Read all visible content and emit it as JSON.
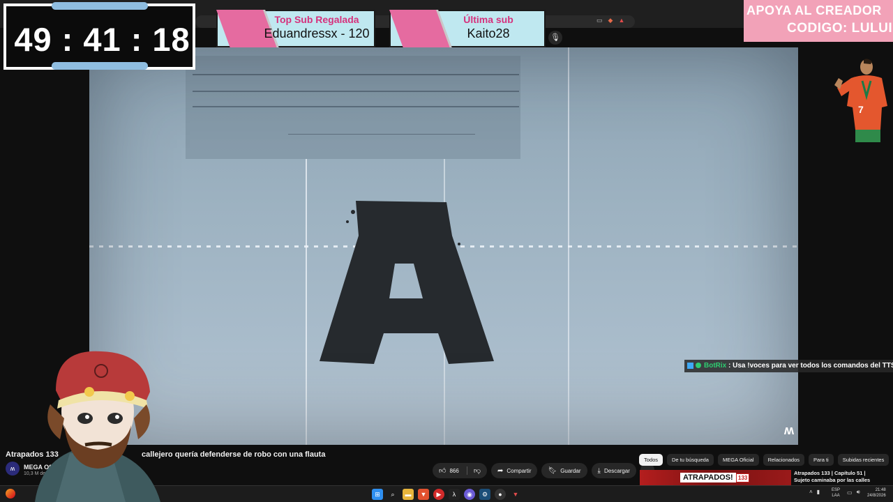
{
  "timer": {
    "value": "49 : 41 : 18"
  },
  "top_sub": {
    "title": "Top Sub Regalada",
    "value": "Eduandressx - 120"
  },
  "last_sub": {
    "title": "Última sub",
    "value": "Kaito28"
  },
  "support": {
    "line1": "APOYA AL CREADOR",
    "line2": "CODIGO: LULUI"
  },
  "chat": {
    "user": "BotRix",
    "message": ": Usa !voces para ver todos los comandos del TTS"
  },
  "video": {
    "title": "Atrapados 133",
    "title_rest": "callejero quería defenderse de robo con una flauta",
    "channel": "MEGA Oficial",
    "subscribers": "10,3 M de susc",
    "letter": "A"
  },
  "actions": {
    "likes": "866",
    "share": "Compartir",
    "save": "Guardar",
    "download": "Descargar",
    "more": "···"
  },
  "chips": [
    "Todos",
    "De tu búsqueda",
    "MEGA Oficial",
    "Relacionados",
    "Para ti",
    "Subidas recientes"
  ],
  "recommended": {
    "thumb_title": "ATRAPADOS!",
    "thumb_num": "133",
    "line1": "Atrapados 133  |  Capítulo 51 |",
    "line2": "Sujeto caminaba por las calles"
  },
  "taskbar": {
    "lang1": "ESP",
    "lang2": "LAA",
    "time": "21:48",
    "date": "24/8/2026"
  },
  "colors": {
    "accent_pink": "#e56ba0",
    "banner_bg": "#bfe8f0",
    "timer_cap": "#8fbde0",
    "youtube_red": "#c61e1e"
  }
}
